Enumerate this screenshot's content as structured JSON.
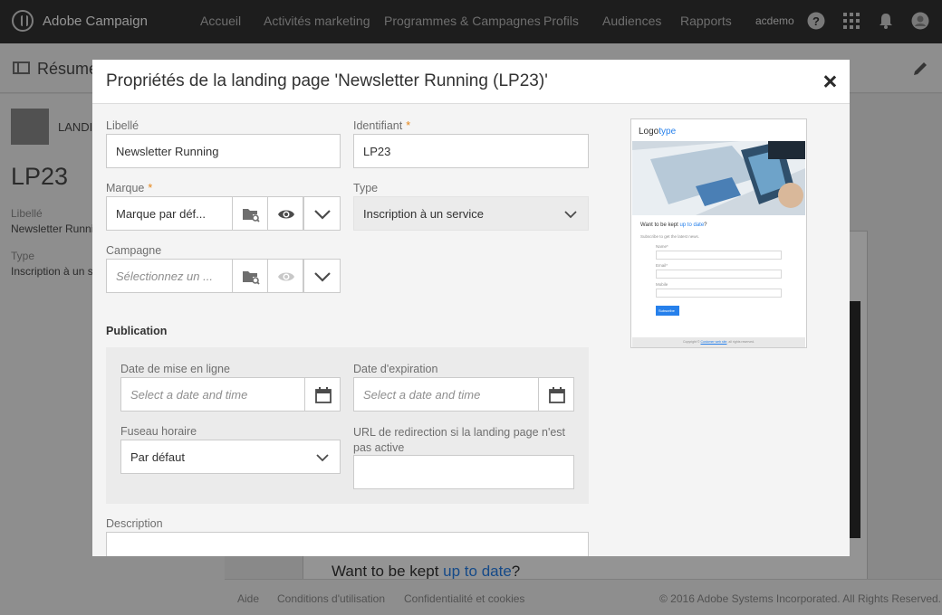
{
  "topbar": {
    "app_title": "Adobe Campaign",
    "nav": [
      "Accueil",
      "Activités marketing",
      "Programmes & Campagnes",
      "Profils",
      "Audiences",
      "Rapports"
    ],
    "user": "acdemo",
    "icons": [
      "help-icon",
      "apps-grid-icon",
      "bell-icon",
      "user-avatar-icon"
    ]
  },
  "background": {
    "summary_title": "Résumé",
    "type_label": "LANDI",
    "code": "LP23",
    "label_label": "Libellé",
    "label_value": "Newsletter Runni",
    "type_field_label": "Type",
    "type_value": "Inscription à un s",
    "preview_want": "Want to be kept ",
    "preview_want_link": "up to date",
    "preview_want_end": "?",
    "footer": {
      "help": "Aide",
      "terms": "Conditions d'utilisation",
      "privacy": "Confidentialité et cookies",
      "copyright": "© 2016 Adobe Systems Incorporated. All Rights Reserved."
    }
  },
  "dialog": {
    "title": "Propriétés de la landing page 'Newsletter Running (LP23)'",
    "libelle": {
      "label": "Libellé",
      "value": "Newsletter Running"
    },
    "identifiant": {
      "label": "Identifiant",
      "required": "*",
      "value": "LP23"
    },
    "marque": {
      "label": "Marque",
      "required": "*",
      "value": "Marque par déf..."
    },
    "type": {
      "label": "Type",
      "value": "Inscription à un service"
    },
    "campagne": {
      "label": "Campagne",
      "placeholder": "Sélectionnez un ..."
    },
    "publication": {
      "title": "Publication",
      "date_online": {
        "label": "Date de mise en ligne",
        "placeholder": "Select a date and time"
      },
      "date_expiry": {
        "label": "Date d'expiration",
        "placeholder": "Select a date and time"
      },
      "timezone": {
        "label": "Fuseau horaire",
        "value": "Par défaut"
      },
      "redirect": {
        "label": "URL de redirection si la landing page n'est pas active",
        "value": ""
      }
    },
    "description": {
      "label": "Description",
      "value": ""
    },
    "thumbnail": {
      "logo_a": "Logo",
      "logo_b": "type",
      "want": "Want to be kept ",
      "want_link": "up to date",
      "want_end": "?",
      "subscribe_text": "Subscribe to get the latest news.",
      "fields": [
        "Name*",
        "Email*",
        "Mobile"
      ],
      "button": "Subscribe",
      "footer_a": "Copyright © ",
      "footer_link": "Customer web site",
      "footer_b": ", all rights reserved."
    }
  },
  "colors": {
    "accent": "#2680eb",
    "required": "#e68619",
    "topbar": "#323232"
  }
}
